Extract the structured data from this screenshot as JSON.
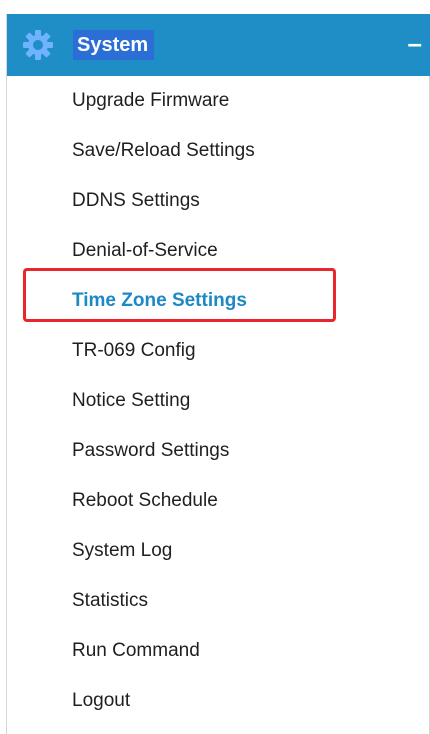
{
  "sidebar": {
    "section_title": "System",
    "collapse_symbol": "–",
    "icon": "gear-icon",
    "colors": {
      "header_bg": "#1f8ec6",
      "title_highlight": "#2b6ed6",
      "active_text": "#1d88c6",
      "selection_box": "#e8262b"
    },
    "items": [
      {
        "label": "Upgrade Firmware"
      },
      {
        "label": "Save/Reload Settings"
      },
      {
        "label": "DDNS Settings"
      },
      {
        "label": "Denial-of-Service"
      },
      {
        "label": "Time Zone Settings"
      },
      {
        "label": "TR-069 Config"
      },
      {
        "label": "Notice Setting"
      },
      {
        "label": "Password Settings"
      },
      {
        "label": "Reboot Schedule"
      },
      {
        "label": "System Log"
      },
      {
        "label": "Statistics"
      },
      {
        "label": "Run Command"
      },
      {
        "label": "Logout"
      }
    ],
    "active_item": "Time Zone Settings"
  }
}
